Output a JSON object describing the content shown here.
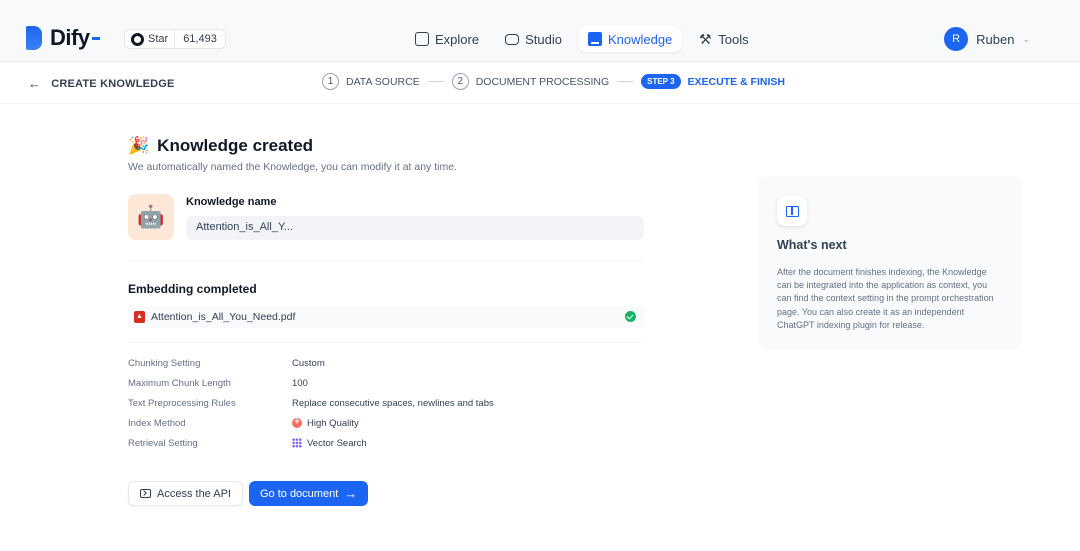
{
  "app": {
    "name": "Dify",
    "github_star_label": "Star",
    "github_star_count": "61,493"
  },
  "nav": {
    "items": [
      {
        "label": "Explore",
        "icon": "compass-icon",
        "active": false
      },
      {
        "label": "Studio",
        "icon": "robot-icon",
        "active": false
      },
      {
        "label": "Knowledge",
        "icon": "book-icon",
        "active": true
      },
      {
        "label": "Tools",
        "icon": "hammer-icon",
        "active": false
      }
    ]
  },
  "user": {
    "initial": "R",
    "name": "Ruben"
  },
  "stepbar": {
    "back_label": "CREATE KNOWLEDGE",
    "steps": [
      {
        "num": "1",
        "label": "DATA SOURCE"
      },
      {
        "num": "2",
        "label": "DOCUMENT PROCESSING"
      },
      {
        "badge": "STEP 3",
        "label": "EXECUTE & FINISH"
      }
    ]
  },
  "main": {
    "title": "Knowledge created",
    "subtitle": "We automatically named the Knowledge, you can modify it at any time.",
    "knowledge_name_label": "Knowledge name",
    "knowledge_name_value": "Attention_is_All_Y...",
    "embedding_title": "Embedding completed",
    "file_name": "Attention_is_All_You_Need.pdf",
    "settings": [
      {
        "key": "Chunking Setting",
        "value": "Custom"
      },
      {
        "key": "Maximum Chunk Length",
        "value": "100"
      },
      {
        "key": "Text Preprocessing Rules",
        "value": "Replace consecutive spaces, newlines and tabs"
      },
      {
        "key": "Index Method",
        "value": "High Quality"
      },
      {
        "key": "Retrieval Setting",
        "value": "Vector Search"
      }
    ],
    "access_api_label": "Access the API",
    "go_to_document_label": "Go to document"
  },
  "next": {
    "title": "What's next",
    "text": "After the document finishes indexing, the Knowledge can be integrated into the application as context, you can find the context setting in the prompt orchestration page. You can also create it as an independent ChatGPT indexing plugin for release."
  },
  "colors": {
    "accent": "#1c64f2",
    "success": "#16b364",
    "pdf": "#d92d20"
  }
}
